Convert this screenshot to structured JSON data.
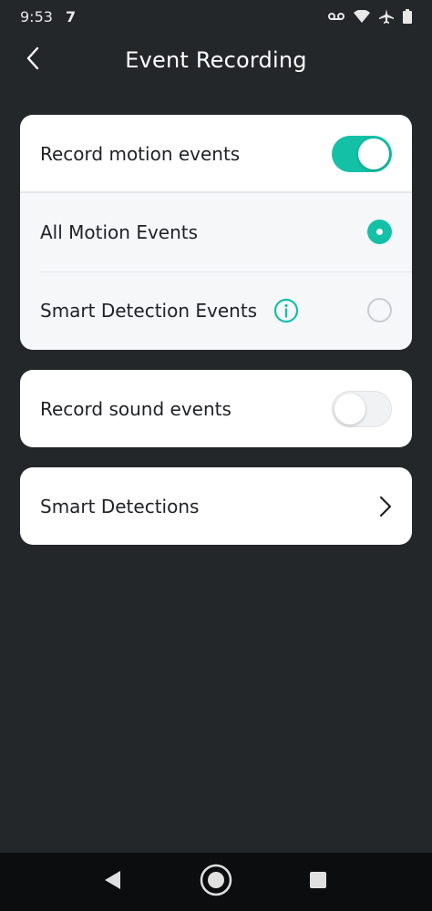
{
  "status_bar": {
    "time": "9:53",
    "notification": "7",
    "icons": [
      "voicemail-icon",
      "wifi-icon",
      "airplane-icon",
      "battery-icon"
    ]
  },
  "header": {
    "title": "Event Recording",
    "back_icon": "chevron-left-icon"
  },
  "motion": {
    "label": "Record motion events",
    "toggle_on": true,
    "options": [
      {
        "label": "All Motion Events",
        "selected": true
      },
      {
        "label": "Smart Detection Events",
        "selected": false,
        "info_icon": "info-icon"
      }
    ]
  },
  "sound": {
    "label": "Record sound events",
    "toggle_on": false
  },
  "smart_detections": {
    "label": "Smart Detections",
    "icon": "chevron-right-icon"
  },
  "nav_bar": {
    "buttons": [
      "back-triangle-icon",
      "home-circle-icon",
      "recents-square-icon"
    ]
  },
  "colors": {
    "background": "#24272a",
    "accent": "#14c1a6",
    "card": "#ffffff",
    "sub_section": "#f5f7f9",
    "nav_bar": "#0c0d0e"
  }
}
